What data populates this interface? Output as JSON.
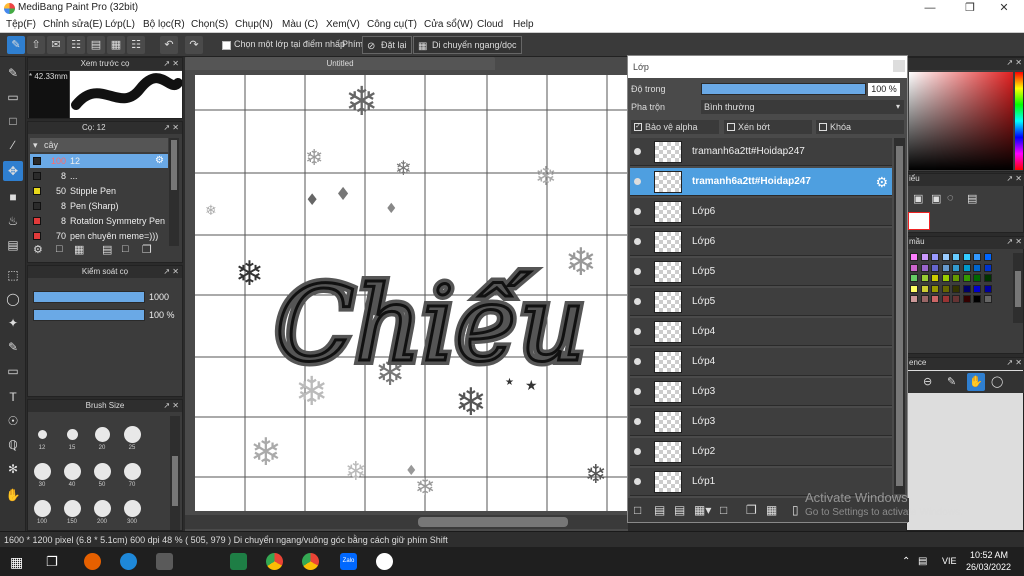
{
  "window": {
    "title": "MediBang Paint Pro (32bit)"
  },
  "menu": [
    "Tệp(F)",
    "Chỉnh sửa(E)",
    "Lớp(L)",
    "Bộ lọc(R)",
    "Chọn(S)",
    "Chụp(N)",
    "Màu (C)",
    "Xem(V)",
    "Công cụ(T)",
    "Cửa sổ(W)",
    "Cloud",
    "Help"
  ],
  "toolbar": {
    "select_one_layer": "Chọn một lớp tại điểm nhấp",
    "key_label": "Phím",
    "reset": "Đặt lại",
    "move_hv": "Di chuyển ngang/dọc"
  },
  "brush_preview": {
    "title": "Xem trước cọ",
    "size": "* 42.33mm"
  },
  "brush_list": {
    "title": "Cọ: 12",
    "group": "cây",
    "items": [
      {
        "size": "100",
        "name": "12",
        "color": "#2b2b2b"
      },
      {
        "size": "8",
        "name": "...",
        "color": "#2b2b2b"
      },
      {
        "size": "50",
        "name": "Stipple Pen",
        "color": "#e8d81a"
      },
      {
        "size": "8",
        "name": "Pen (Sharp)",
        "color": "#2b2b2b"
      },
      {
        "size": "8",
        "name": "Rotation Symmetry Pen",
        "color": "#e23a3a"
      },
      {
        "size": "70",
        "name": "pen chuyên meme=)))",
        "color": "#e23a3a"
      }
    ]
  },
  "brush_control": {
    "title": "Kiểm soát cọ",
    "size_value": "1000",
    "size_level": 1.0,
    "opacity_value": "100 %",
    "opacity_level": 1.0
  },
  "brush_size": {
    "title": "Brush Size",
    "sizes": [
      "12",
      "15",
      "20",
      "25",
      "30",
      "40",
      "50",
      "70",
      "100",
      "150",
      "200",
      "300"
    ]
  },
  "canvas": {
    "tab": "Untitled",
    "text": "Chiếu"
  },
  "layers": {
    "title": "Lớp",
    "opacity_label": "Độ trong",
    "opacity_value": "100 %",
    "opacity_level": 1.0,
    "blend_label": "Pha trộn",
    "blend_value": "Bình thường",
    "protect_alpha": "Bảo vệ alpha",
    "clip": "Xén bớt",
    "lock": "Khóa",
    "items": [
      "tramanh6a2tt#Hoidap247",
      "tramanh6a2tt#Hoidap247",
      "Lớp6",
      "Lớp6",
      "Lớp5",
      "Lớp5",
      "Lớp4",
      "Lớp4",
      "Lớp3",
      "Lớp3",
      "Lớp2",
      "Lớp1"
    ],
    "selected_index": 1
  },
  "right_panels": {
    "nav_label": "iểu",
    "color_label": "mầu",
    "ref_label": "ence"
  },
  "status": "1600 * 1200 pixel  (6.8 * 5.1cm)  600 dpi  48 %  ( 505, 979 )  Di chuyển ngang/vuông góc bằng cách giữ phím Shift",
  "activate": {
    "line1": "Activate Windows",
    "line2": "Go to Settings to activate Windows."
  },
  "taskbar": {
    "time": "10:52 AM",
    "date": "26/03/2022",
    "lang": "VIE",
    "zalo": "Zalo"
  },
  "colors": {
    "accent": "#2f7fd0",
    "selected_layer": "#4e9fe0",
    "slider": "#6aa9e6"
  }
}
